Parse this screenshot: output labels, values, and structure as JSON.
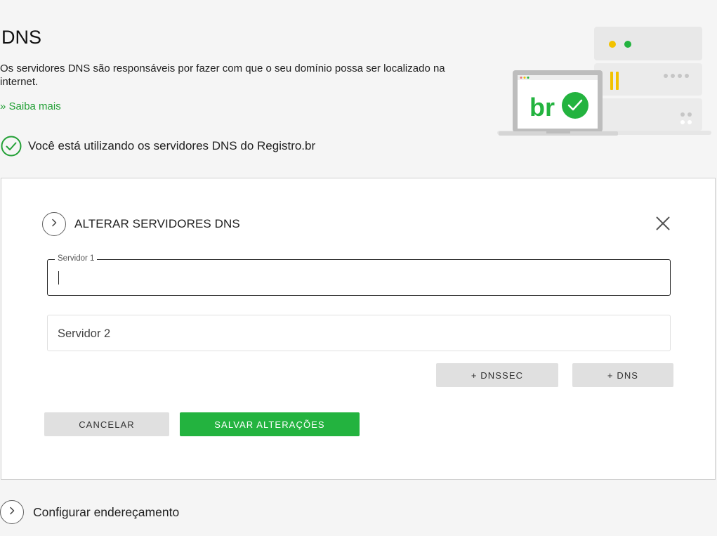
{
  "page": {
    "title": "DNS",
    "description": "Os servidores DNS são responsáveis por fazer com que o seu domínio possa ser localizado na internet.",
    "learn_more": "» Saiba mais",
    "status": "Você está utilizando os servidores DNS do Registro.br"
  },
  "illustration": {
    "logo_text": "br"
  },
  "dns_panel": {
    "title": "ALTERAR SERVIDORES DNS",
    "server1": {
      "label": "Servidor 1",
      "value": ""
    },
    "server2": {
      "placeholder": "Servidor 2",
      "value": ""
    },
    "add_dnssec": "+ DNSSEC",
    "add_dns": "+ DNS",
    "cancel": "CANCELAR",
    "save": "SALVAR ALTERAÇÕES"
  },
  "addressing": {
    "label": "Configurar endereçamento"
  },
  "colors": {
    "accent_green": "#23b33f",
    "link_green": "#23a036",
    "button_grey": "#e0e0e0",
    "background": "#f5f5f5"
  },
  "icons": {
    "status": "check-circle-icon",
    "expand": "chevron-right-icon",
    "close": "close-icon"
  }
}
